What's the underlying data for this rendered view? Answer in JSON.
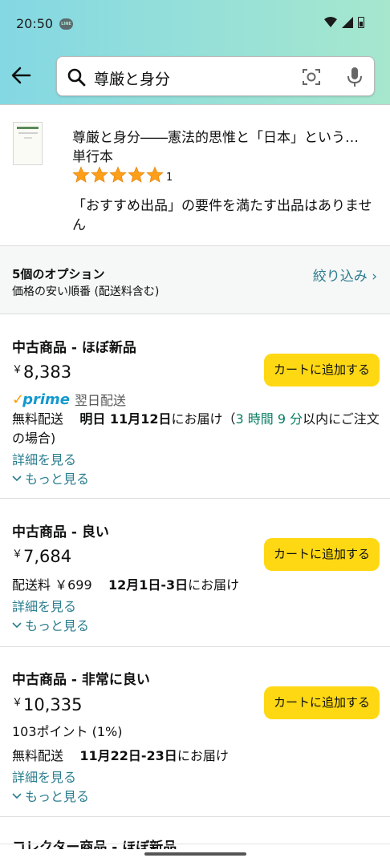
{
  "status": {
    "time": "20:50",
    "line_badge": "LINE"
  },
  "search": {
    "query": "尊厳と身分"
  },
  "product": {
    "title": "尊厳と身分――憲法的思惟と「日本」という…",
    "format": "単行本",
    "rating_count": "1",
    "notice": "「おすすめ出品」の要件を満たす出品はありません",
    "stars": 5
  },
  "options": {
    "count": "5個のオプション",
    "sort": "価格の安い順番 (配送料含む)",
    "filter": "絞り込み ›"
  },
  "offers": [
    {
      "condition": "中古商品 - ほぼ新品",
      "yen": "￥",
      "price": "8,383",
      "cart": "カートに追加する",
      "prime_label": "prime",
      "prime_next_day": "翌日配送",
      "ship_prefix": "無料配送",
      "ship_date": "明日 11月12日",
      "ship_suffix": "にお届け（",
      "countdown": "3 時間 9 分",
      "ship_tail": "以内にご注文の場合)",
      "details": "詳細を見る",
      "more": "もっと見る"
    },
    {
      "condition": "中古商品 - 良い",
      "yen": "￥",
      "price": "7,684",
      "cart": "カートに追加する",
      "ship_prefix": "配送料 ￥699",
      "ship_date": "12月1日-3日",
      "ship_suffix": "にお届け",
      "details": "詳細を見る",
      "more": "もっと見る"
    },
    {
      "condition": "中古商品 - 非常に良い",
      "yen": "￥",
      "price": "10,335",
      "cart": "カートに追加する",
      "points": "103ポイント (1%)",
      "ship_prefix": "無料配送",
      "ship_date": "11月22日-23日",
      "ship_suffix": "にお届け",
      "details": "詳細を見る",
      "more": "もっと見る"
    }
  ],
  "partial_next": "コレクター商品 - ほぼ新品",
  "colors": {
    "cart_button": "#ffd814",
    "link": "#2a7d8e",
    "star": "#ff9e18",
    "countdown": "#067d62"
  }
}
